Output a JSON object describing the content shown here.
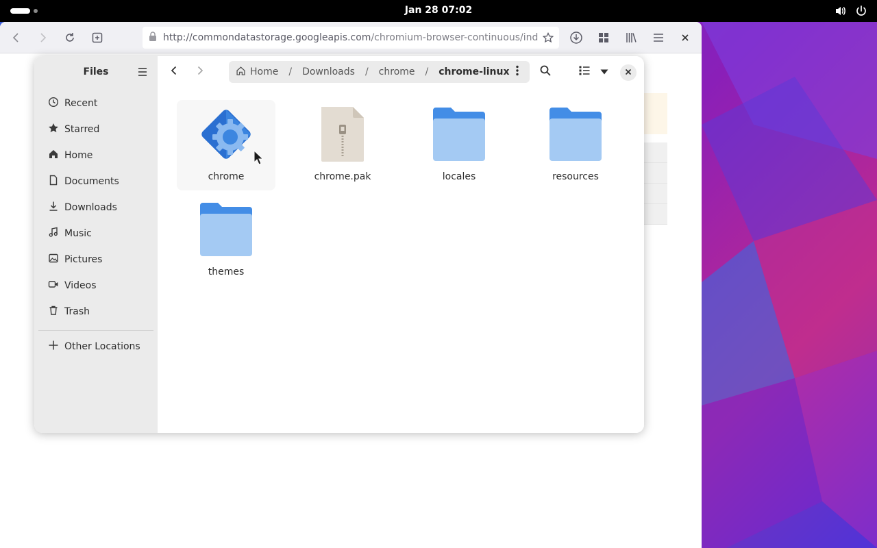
{
  "topbar": {
    "clock": "Jan 28  07:02"
  },
  "browser": {
    "url_host": "http://commondatastorage.googleapis.com",
    "url_path": "/chromium-browser-continuous/index.ht"
  },
  "files": {
    "sidebar": {
      "title": "Files",
      "items": [
        {
          "label": "Recent",
          "icon": "recent-icon"
        },
        {
          "label": "Starred",
          "icon": "star-icon"
        },
        {
          "label": "Home",
          "icon": "home-icon"
        },
        {
          "label": "Documents",
          "icon": "document-icon"
        },
        {
          "label": "Downloads",
          "icon": "download-icon"
        },
        {
          "label": "Music",
          "icon": "music-icon"
        },
        {
          "label": "Pictures",
          "icon": "picture-icon"
        },
        {
          "label": "Videos",
          "icon": "video-icon"
        },
        {
          "label": "Trash",
          "icon": "trash-icon"
        }
      ],
      "other_locations": "Other Locations"
    },
    "path": {
      "crumbs": [
        "Home",
        "Downloads",
        "chrome",
        "chrome-linux"
      ]
    },
    "items": [
      {
        "label": "chrome",
        "type": "executable"
      },
      {
        "label": "chrome.pak",
        "type": "archive"
      },
      {
        "label": "locales",
        "type": "folder"
      },
      {
        "label": "resources",
        "type": "folder"
      },
      {
        "label": "themes",
        "type": "folder"
      }
    ]
  },
  "colors": {
    "folder_light": "#a4caf3",
    "folder_dark": "#438de6",
    "exec_blue": "#2a6fd1",
    "sidebar_bg": "#ebebeb"
  }
}
